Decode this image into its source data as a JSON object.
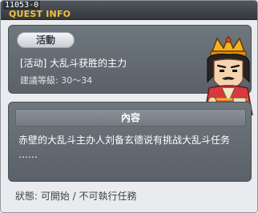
{
  "window": {
    "quest_id": "11053-0",
    "title": "QUEST INFO",
    "close_glyph": "×"
  },
  "quest": {
    "tag": "活動",
    "name": "[活动] 大乱斗获胜的主力",
    "level": "建議等級: 30～34"
  },
  "content": {
    "header": "內容",
    "lines": [
      "赤壁的大乱斗主办人刘备玄德说有挑战大乱斗任务",
      "……"
    ]
  },
  "status": {
    "text": "狀態: 可開始 / 不可執行任務"
  },
  "colors": {
    "title_gold": "#f1c233",
    "panel_gray": "#666d74",
    "window_bg": "#e9ebee"
  },
  "icons": {
    "npc": "npc-portrait-liu-bei",
    "close": "close-icon"
  }
}
